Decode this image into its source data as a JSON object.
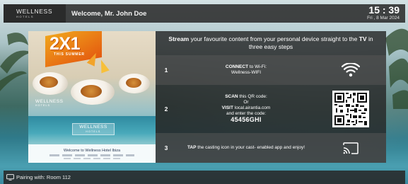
{
  "header": {
    "brand_main": "WELLNESS",
    "brand_sub": "HOTELS",
    "welcome_text": "Welcome, Mr. John Doe",
    "time": "15 : 39",
    "date": "Fri , 8 Mar 2024"
  },
  "promo": {
    "headline": "2X1",
    "tagline": "THIS SUMMER",
    "logo_main": "WELLNESS",
    "logo_sub": "HOTELS",
    "caption": "Welcome to Wellness Hotel Ibiza"
  },
  "panel": {
    "title_bold_1": "Stream",
    "title_text_1": " your favourite content from your personal device straight to the ",
    "title_bold_2": "TV",
    "title_text_2": " in three easy steps",
    "steps": [
      {
        "number": "1",
        "line1_bold": "CONNECT",
        "line1_text": " to Wi-Fi:",
        "line2": "Wellness-WIFI",
        "icon": "wifi-icon"
      },
      {
        "number": "2",
        "line1_bold": "SCAN",
        "line1_text": " this QR code:",
        "line2": "Or",
        "line3_bold": "VISIT",
        "line3_text": " local.airantia.com",
        "line4": "and enter the code:",
        "code": "45456GHI",
        "icon": "qr-code-icon"
      },
      {
        "number": "3",
        "line1_bold": "TAP",
        "line1_text": " the casting icon in your cast- enabled app and enjoy!",
        "icon": "cast-icon"
      }
    ]
  },
  "footer": {
    "pairing_text": "Pairing with: Room 112"
  },
  "colors": {
    "bar_background": "#282828",
    "panel_background": "#262626",
    "promo_orange": "#f0a31c"
  }
}
